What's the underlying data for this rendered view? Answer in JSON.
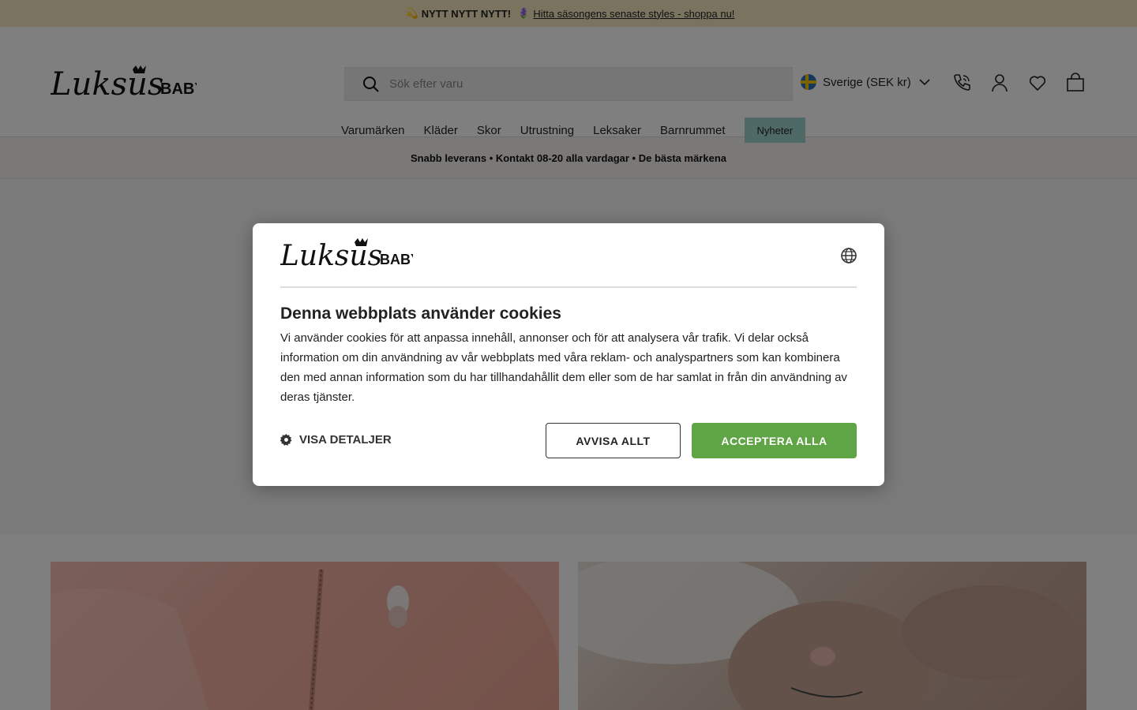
{
  "announcement": {
    "icon_left": "💫",
    "bold": "NYTT NYTT NYTT!",
    "icon_mid": "🪻",
    "link": "Hitta säsongens senaste styles - shoppa nu!"
  },
  "header": {
    "logo_script": "Luksus",
    "logo_word": "BABY",
    "search_placeholder": "Sök efter varu",
    "country_label": "Sverige (SEK kr)",
    "icons": [
      "phone-icon",
      "account-icon",
      "wishlist-icon",
      "cart-icon"
    ]
  },
  "nav": {
    "items": [
      "Varumärken",
      "Kläder",
      "Skor",
      "Utrustning",
      "Leksaker",
      "Barnrummet"
    ],
    "highlight": "Nyheter"
  },
  "usp": {
    "text": "Snabb leverans • Kontakt 08-20 alla vardagar • De bästa märkena"
  },
  "cookie_modal": {
    "logo_script": "Luksus",
    "logo_word": "BABY",
    "title": "Denna webbplats använder cookies",
    "body": "Vi använder cookies för att anpassa innehåll, annonser och för att analysera vår trafik. Vi delar också information om din användning av vår webbplats med våra reklam- och analyspartners som kan kombinera den med annan information som du har tillhandahållit dem eller som de har samlat in från din användning av deras tjänster.",
    "details_label": "VISA DETALJER",
    "reject_label": "AVVISA ALLT",
    "accept_label": "ACCEPTERA ALLA"
  },
  "colors": {
    "announcement_bg": "#f3e7bf",
    "news_bg": "#9fd2cc",
    "accept_green": "#60a545",
    "overlay": "rgba(0,0,0,0.5)"
  }
}
